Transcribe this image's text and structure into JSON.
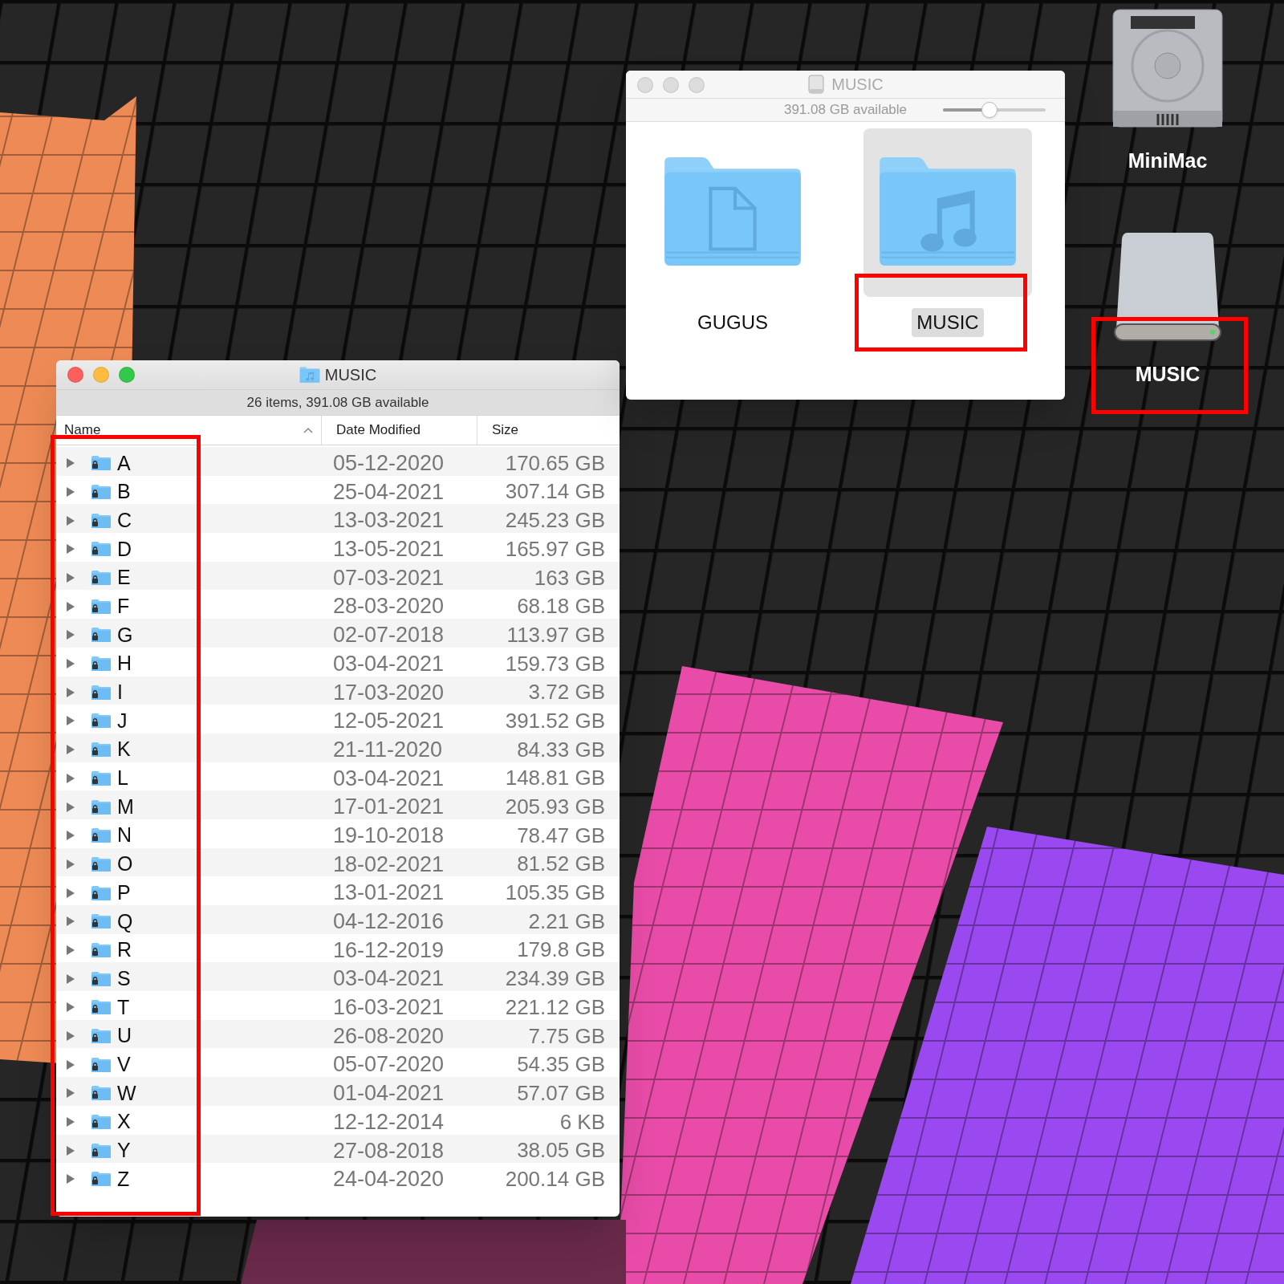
{
  "list_window": {
    "title": "MUSIC",
    "active": true,
    "status": "26 items, 391.08 GB available",
    "columns": [
      {
        "label": "Name",
        "sorted": true
      },
      {
        "label": "Date Modified",
        "sorted": false
      },
      {
        "label": "Size",
        "sorted": false
      }
    ],
    "rows": [
      {
        "name": "A",
        "date": "05-12-2020",
        "size": "170.65 GB",
        "expanded": false
      },
      {
        "name": "B",
        "date": "25-04-2021",
        "size": "307.14 GB",
        "expanded": false
      },
      {
        "name": "C",
        "date": "13-03-2021",
        "size": "245.23 GB",
        "expanded": false
      },
      {
        "name": "D",
        "date": "13-05-2021",
        "size": "165.97 GB",
        "expanded": false
      },
      {
        "name": "E",
        "date": "07-03-2021",
        "size": "163 GB",
        "expanded": false
      },
      {
        "name": "F",
        "date": "28-03-2020",
        "size": "68.18 GB",
        "expanded": false
      },
      {
        "name": "G",
        "date": "02-07-2018",
        "size": "113.97 GB",
        "expanded": false
      },
      {
        "name": "H",
        "date": "03-04-2021",
        "size": "159.73 GB",
        "expanded": false
      },
      {
        "name": "I",
        "date": "17-03-2020",
        "size": "3.72 GB",
        "expanded": false
      },
      {
        "name": "J",
        "date": "12-05-2021",
        "size": "391.52 GB",
        "expanded": false
      },
      {
        "name": "K",
        "date": "21-11-2020",
        "size": "84.33 GB",
        "expanded": false
      },
      {
        "name": "L",
        "date": "03-04-2021",
        "size": "148.81 GB",
        "expanded": false
      },
      {
        "name": "M",
        "date": "17-01-2021",
        "size": "205.93 GB",
        "expanded": false
      },
      {
        "name": "N",
        "date": "19-10-2018",
        "size": "78.47 GB",
        "expanded": false
      },
      {
        "name": "O",
        "date": "18-02-2021",
        "size": "81.52 GB",
        "expanded": false
      },
      {
        "name": "P",
        "date": "13-01-2021",
        "size": "105.35 GB",
        "expanded": false
      },
      {
        "name": "Q",
        "date": "04-12-2016",
        "size": "2.21 GB",
        "expanded": false
      },
      {
        "name": "R",
        "date": "16-12-2019",
        "size": "179.8 GB",
        "expanded": false
      },
      {
        "name": "S",
        "date": "03-04-2021",
        "size": "234.39 GB",
        "expanded": false
      },
      {
        "name": "T",
        "date": "16-03-2021",
        "size": "221.12 GB",
        "expanded": false
      },
      {
        "name": "U",
        "date": "26-08-2020",
        "size": "7.75 GB",
        "expanded": false
      },
      {
        "name": "V",
        "date": "05-07-2020",
        "size": "54.35 GB",
        "expanded": false
      },
      {
        "name": "W",
        "date": "01-04-2021",
        "size": "57.07 GB",
        "expanded": false
      },
      {
        "name": "X",
        "date": "12-12-2014",
        "size": "6 KB",
        "expanded": false
      },
      {
        "name": "Y",
        "date": "27-08-2018",
        "size": "38.05 GB",
        "expanded": false
      },
      {
        "name": "Z",
        "date": "24-04-2020",
        "size": "200.14 GB",
        "expanded": false
      }
    ]
  },
  "icon_window": {
    "title": "MUSIC",
    "active": false,
    "status": "391.08 GB available",
    "zoom": {
      "level": 0.45
    },
    "items": [
      {
        "name": "GUGUS",
        "kind": "documents",
        "selected": false
      },
      {
        "name": "MUSIC",
        "kind": "music",
        "selected": true
      }
    ]
  },
  "desktop_icons": [
    {
      "label": "MiniMac",
      "kind": "internal-disk"
    },
    {
      "label": "MUSIC",
      "kind": "external-disk"
    }
  ]
}
